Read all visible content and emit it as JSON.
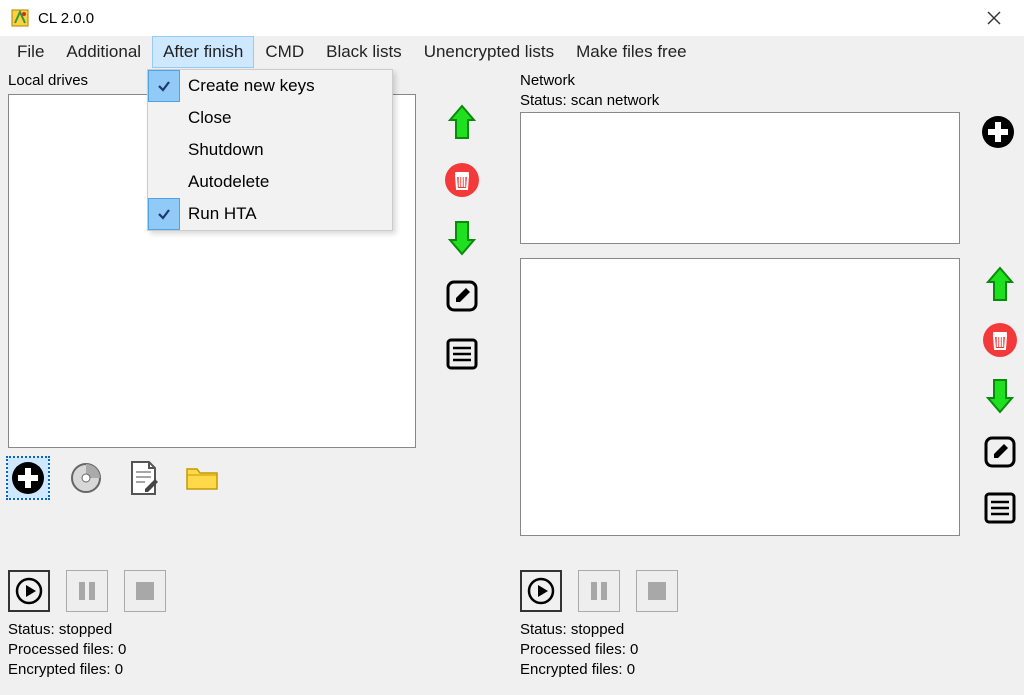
{
  "title": "CL 2.0.0",
  "menu": {
    "file": "File",
    "additional": "Additional",
    "after_finish": "After finish",
    "cmd": "CMD",
    "black_lists": "Black lists",
    "unencrypted_lists": "Unencrypted lists",
    "make_files_free": "Make files free"
  },
  "after_finish_menu": {
    "items": [
      {
        "label": "Create new keys",
        "checked": true
      },
      {
        "label": "Close",
        "checked": false
      },
      {
        "label": "Shutdown",
        "checked": false
      },
      {
        "label": "Autodelete",
        "checked": false
      },
      {
        "label": "Run HTA",
        "checked": true
      }
    ]
  },
  "left": {
    "heading": "Local drives",
    "status_line": "Status: stopped",
    "processed_line": "Processed files: 0",
    "encrypted_line": "Encrypted files: 0"
  },
  "right": {
    "heading": "Network",
    "scan_status": "Status: scan network",
    "status_line": "Status: stopped",
    "processed_line": "Processed files: 0",
    "encrypted_line": "Encrypted files: 0"
  },
  "icons": {
    "up": "arrow-up",
    "down": "arrow-down",
    "trash": "trash",
    "edit": "edit",
    "list": "list",
    "plus_black": "plus-circle-black",
    "plus_blue": "plus-circle-blue",
    "disk": "disk",
    "doc_edit": "document-edit",
    "folder": "folder",
    "play": "play",
    "pause": "pause",
    "stop": "stop"
  }
}
